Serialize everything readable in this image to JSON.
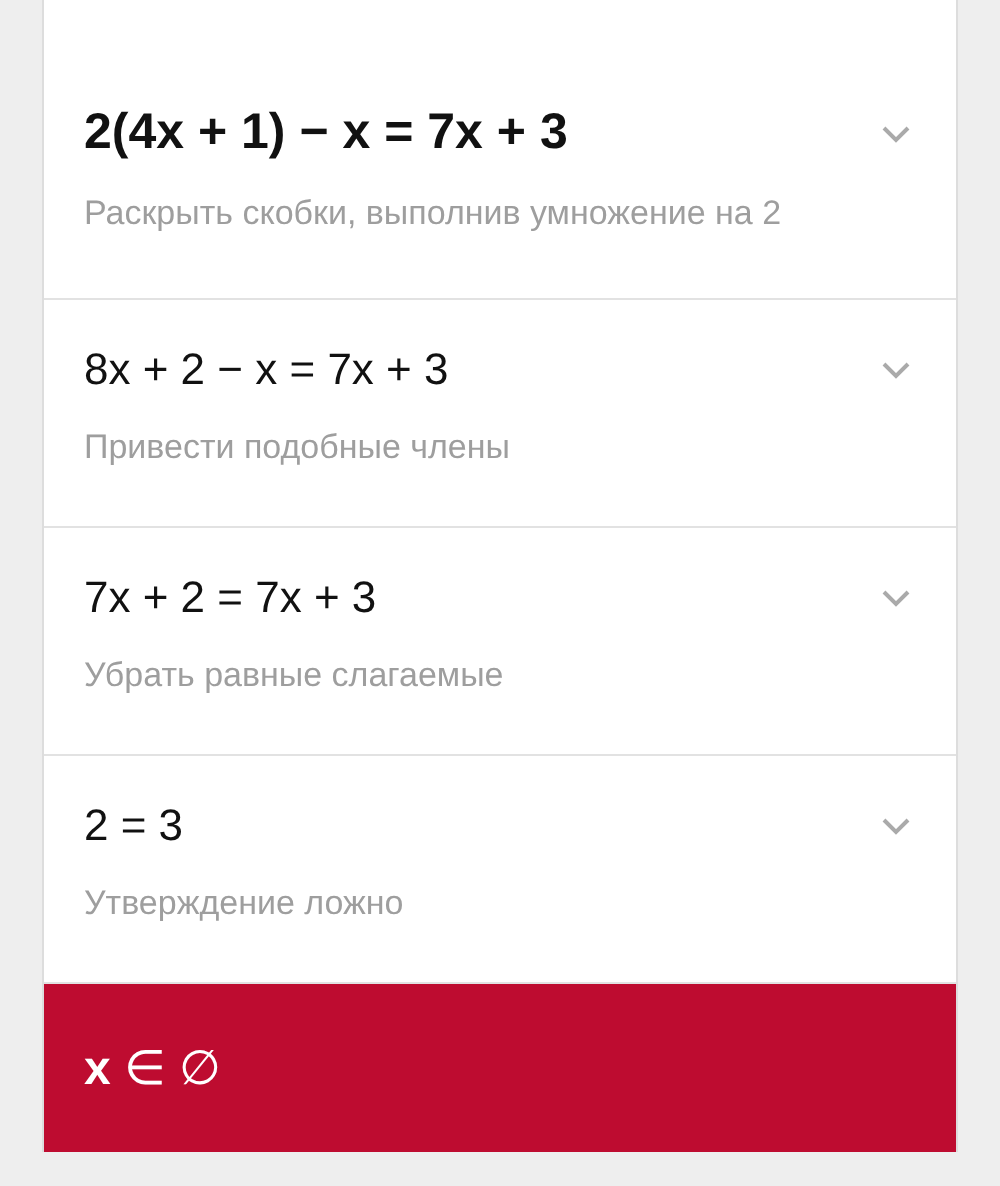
{
  "steps": [
    {
      "equation": "2(4x + 1) − x = 7x + 3",
      "explanation": "Раскрыть скобки, выполнив умножение на 2",
      "emphasized": true,
      "expanded": false
    },
    {
      "equation": "8x + 2 − x = 7x + 3",
      "explanation": "Привести подобные члены",
      "emphasized": false,
      "expanded": false
    },
    {
      "equation": "7x + 2 = 7x + 3",
      "explanation": "Убрать равные слагаемые",
      "emphasized": false,
      "expanded": false
    },
    {
      "equation": "2 = 3",
      "explanation": "Утверждение ложно",
      "emphasized": false,
      "expanded": false
    }
  ],
  "answer": "**x** ∈ ∅"
}
